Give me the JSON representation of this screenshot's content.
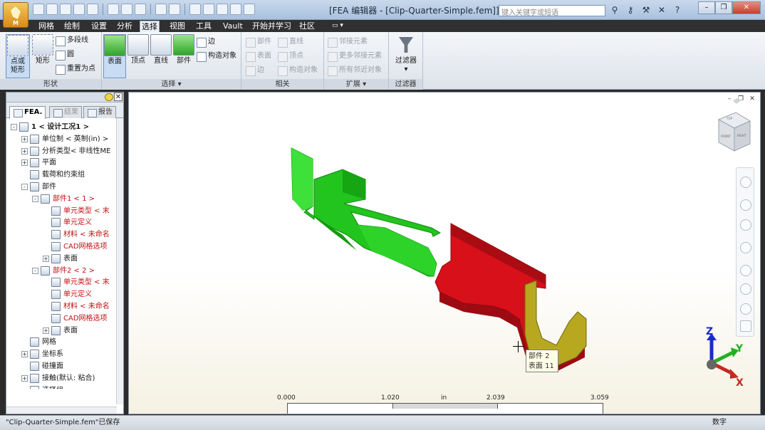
{
  "window": {
    "title": "[FEA 编辑器 - [Clip-Quarter-Simple.fem]]",
    "search_placeholder": "键入关键字或短语",
    "app_button_label": "M"
  },
  "ribbon_tabs": [
    "网格",
    "绘制",
    "设置",
    "分析",
    "选择",
    "视图",
    "工具",
    "Vault",
    "开始并学习",
    "社区"
  ],
  "active_tab": "选择",
  "ribbon": {
    "shape_panel": {
      "label": "形状",
      "point_rect": "点或\n矩形",
      "rect": "矩形",
      "polyline": "多段线",
      "circle": "圆",
      "reset_point": "重置为点"
    },
    "select_panel": {
      "label": "选择",
      "surface": "表面",
      "vertex": "顶点",
      "line": "直线",
      "part": "部件",
      "edge": "边",
      "construction": "构造对象"
    },
    "related_panel": {
      "label": "相关",
      "part": "部件",
      "surface": "表面",
      "edge": "边",
      "line": "直线",
      "vertex": "顶点",
      "construction": "构造对象"
    },
    "extend_panel": {
      "label": "扩展",
      "adjacent": "邻接元素",
      "more_adjacent": "更多邻接元素",
      "all_adjacent": "所有邻近对象"
    },
    "filter_panel": {
      "label": "过滤器",
      "filter": "过滤器"
    }
  },
  "browser": {
    "tabs": [
      "FEA.",
      "结果",
      "报告"
    ],
    "tree": [
      {
        "label": "1 < 设计工况1 >",
        "level": 0,
        "toggle": "-",
        "bold": true,
        "red": false
      },
      {
        "label": "单位制 < 英制(in) >",
        "level": 1,
        "toggle": "+",
        "bold": false,
        "red": false
      },
      {
        "label": "分析类型< 非线性ME",
        "level": 1,
        "toggle": "+",
        "bold": false,
        "red": false
      },
      {
        "label": "平面",
        "level": 1,
        "toggle": "+",
        "bold": false,
        "red": false
      },
      {
        "label": "载荷和约束组",
        "level": 1,
        "toggle": "",
        "bold": false,
        "red": false
      },
      {
        "label": "部件",
        "level": 1,
        "toggle": "-",
        "bold": false,
        "red": false
      },
      {
        "label": "部件1 < 1 >",
        "level": 2,
        "toggle": "-",
        "bold": false,
        "red": true
      },
      {
        "label": "单元类型 < 末",
        "level": 3,
        "toggle": "",
        "bold": false,
        "red": true
      },
      {
        "label": "单元定义",
        "level": 3,
        "toggle": "",
        "bold": false,
        "red": true
      },
      {
        "label": "材料 < 未命名",
        "level": 3,
        "toggle": "",
        "bold": false,
        "red": true
      },
      {
        "label": "CAD网格选项",
        "level": 3,
        "toggle": "",
        "bold": false,
        "red": true
      },
      {
        "label": "表面",
        "level": 3,
        "toggle": "+",
        "bold": false,
        "red": false
      },
      {
        "label": "部件2 < 2 >",
        "level": 2,
        "toggle": "-",
        "bold": false,
        "red": true
      },
      {
        "label": "单元类型 < 末",
        "level": 3,
        "toggle": "",
        "bold": false,
        "red": true
      },
      {
        "label": "单元定义",
        "level": 3,
        "toggle": "",
        "bold": false,
        "red": true
      },
      {
        "label": "材料 < 未命名",
        "level": 3,
        "toggle": "",
        "bold": false,
        "red": true
      },
      {
        "label": "CAD网格选项",
        "level": 3,
        "toggle": "",
        "bold": false,
        "red": true
      },
      {
        "label": "表面",
        "level": 3,
        "toggle": "+",
        "bold": false,
        "red": false
      },
      {
        "label": "网格",
        "level": 1,
        "toggle": "",
        "bold": false,
        "red": false
      },
      {
        "label": "坐标系",
        "level": 1,
        "toggle": "+",
        "bold": false,
        "red": false
      },
      {
        "label": "碰撞面",
        "level": 1,
        "toggle": "",
        "bold": false,
        "red": false
      },
      {
        "label": "接触(默认: 粘合)",
        "level": 1,
        "toggle": "+",
        "bold": false,
        "red": false
      },
      {
        "label": "选择组",
        "level": 1,
        "toggle": "",
        "bold": false,
        "red": false
      }
    ]
  },
  "viewport": {
    "viewcube_face_left": "FRONT",
    "viewcube_face_right": "RIGHT",
    "viewcube_face_top": "TOP",
    "scale_ticks": [
      "0.000",
      "1.020",
      "2.039",
      "3.059"
    ],
    "scale_unit": "in",
    "tooltip_line1": "部件 2",
    "tooltip_line2": "表面 11",
    "axis_x": "X",
    "axis_y": "Y",
    "axis_z": "Z",
    "part1_color": "#22c41e",
    "part2_color": "#d8101a",
    "part2_selected_face_color": "#b8a820"
  },
  "statusbar": {
    "message": "\"Clip-Quarter-Simple.fem\"已保存",
    "mode": "数字"
  },
  "colors": {
    "tab_bar": "#303030",
    "title_bar": "#a9c1de",
    "ribbon_bg": "#dde3ea",
    "tree_red": "#c21016"
  }
}
